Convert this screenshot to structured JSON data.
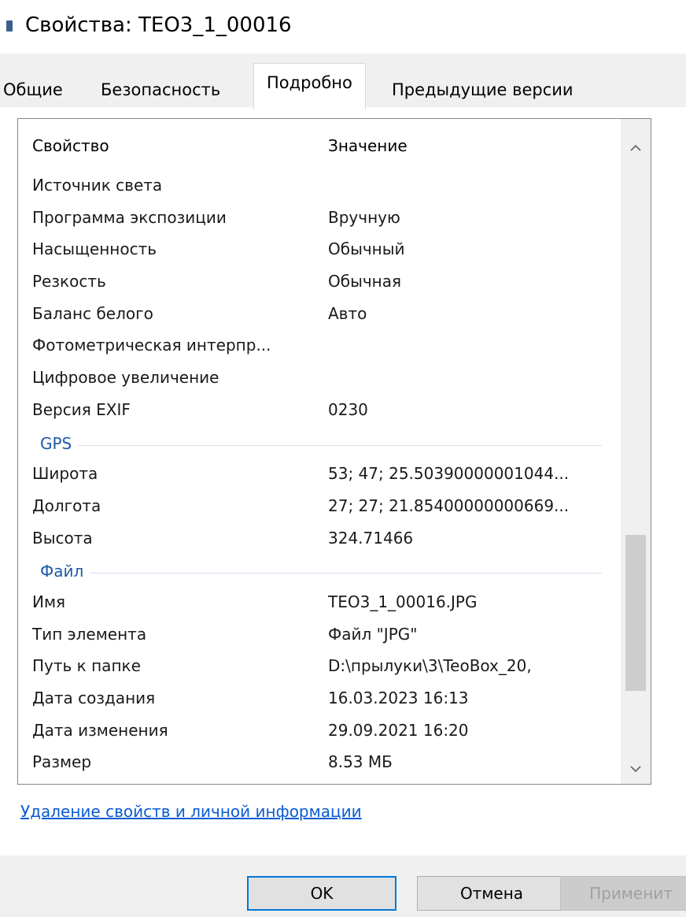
{
  "window": {
    "title": "Свойства: TEO3_1_00016"
  },
  "tabs": [
    {
      "label": "Общие"
    },
    {
      "label": "Безопасность"
    },
    {
      "label": "Подробно"
    },
    {
      "label": "Предыдущие версии"
    }
  ],
  "list": {
    "header": {
      "property": "Свойство",
      "value": "Значение"
    },
    "rows_top": [
      {
        "name": "Источник света",
        "value": ""
      },
      {
        "name": "Программа экспозиции",
        "value": "Вручную"
      },
      {
        "name": "Насыщенность",
        "value": "Обычный"
      },
      {
        "name": "Резкость",
        "value": "Обычная"
      },
      {
        "name": "Баланс белого",
        "value": "Авто"
      },
      {
        "name": "Фотометрическая интерпр...",
        "value": ""
      },
      {
        "name": "Цифровое увеличение",
        "value": ""
      },
      {
        "name": "Версия EXIF",
        "value": "0230"
      }
    ],
    "group_gps": "GPS",
    "rows_gps": [
      {
        "name": "Широта",
        "value": "53; 47; 25.50390000001044..."
      },
      {
        "name": "Долгота",
        "value": "27; 27; 21.85400000000669..."
      },
      {
        "name": "Высота",
        "value": "324.71466"
      }
    ],
    "group_file": "Файл",
    "rows_file": [
      {
        "name": "Имя",
        "value": "TEO3_1_00016.JPG"
      },
      {
        "name": "Тип элемента",
        "value": "Файл \"JPG\""
      },
      {
        "name": "Путь к папке",
        "value": "D:\\прылуки\\3\\TeoBox_20,"
      },
      {
        "name": "Дата создания",
        "value": "16.03.2023 16:13"
      },
      {
        "name": "Дата изменения",
        "value": "29.09.2021 16:20"
      },
      {
        "name": "Размер",
        "value": "8.53 МБ"
      }
    ]
  },
  "scrollbar": {
    "up_icon": "chevron-up-icon",
    "down_icon": "chevron-down-icon"
  },
  "link": {
    "label": "Удаление свойств и личной информации"
  },
  "buttons": {
    "ok": "OK",
    "cancel": "Отмена",
    "apply": "Применит"
  }
}
